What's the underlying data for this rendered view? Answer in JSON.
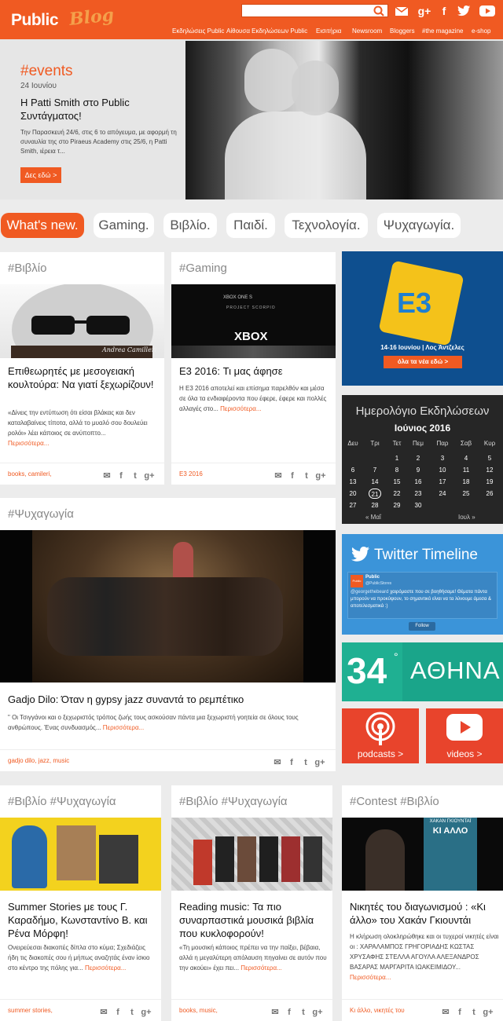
{
  "header": {
    "logo_public": "Public",
    "logo_blog": "Blog",
    "search_placeholder": "",
    "nav": [
      "Εκδηλώσεις Public",
      "Αίθουσα Εκδηλώσεων Public",
      "Εισιτήρια",
      "Newsroom",
      "Bloggers",
      "#the magazine",
      "e-shop"
    ]
  },
  "hero": {
    "tag": "#events",
    "date": "24 Ιουνίου",
    "title": "Η Patti Smith στο Public Συντάγματος!",
    "text": "Την Παρασκευή 24/6, στις 6 το απόγευμα, με αφορμή τη συναυλία της στο Piraeus Academy στις 25/6, η Patti Smith, ιέρεια τ...",
    "button": "Δες εδώ >"
  },
  "tabs": [
    "What's new.",
    "Gaming.",
    "Βιβλίο.",
    "Παιδί.",
    "Τεχνολογία.",
    "Ψυχαγωγία."
  ],
  "cards": {
    "c1": {
      "tag": "#Βιβλίο",
      "title": "Επιθεωρητές με μεσογειακή κουλτούρα: Να γιατί ξεχωρίζουν!",
      "text": "«Δίνεις την εντύπωση ότι είσαι βλάκας και δεν καταλαβαίνεις τίποτα, αλλά το μυαλό σου δουλεύει ρολόι» λέει κάποιος σε ανύποπτο...",
      "more": "Περισσότερα...",
      "tags": "books,  camileri,",
      "img_caption": "Andrea Camilleri"
    },
    "c2": {
      "tag": "#Gaming",
      "title": "E3 2016: Τι μας άφησε",
      "text": "Η E3 2016 αποτελεί και επίσημα παρελθόν και μέσα σε όλα τα ενδιαφέροντα που έφερε, έφερε και πολλές αλλαγές στο...",
      "more": "Περισσότερα...",
      "tags": "E3 2016",
      "img_text": "XBOX",
      "img_sub": "PROJECT SCORPIO",
      "img_top": "XBOX ONE S"
    },
    "c3": {
      "tag": "#Ψυχαγωγία",
      "title": "Gadjo Dilo: Όταν η gypsy jazz συναντά το ρεμπέτικο",
      "text": "\" Οι Τσιγγάνοι και ο ξεχωριστός τρόπος ζωής τους ασκούσαν πάντα μια ξεχωριστή γοητεία σε όλους τους ανθρώπους. Ένας συνδυασμός...",
      "more": "Περισσότερα...",
      "tags": "gadjo dilo,  jazz,  music"
    },
    "c4": {
      "tag": "#Βιβλίο #Ψυχαγωγία",
      "title": "Summer Stories με τους Γ. Καραδήμο, Κωνσταντίνο Β. και Ρένα Μόρφη!",
      "text": "Ονειρεύεσαι διακοπές δίπλα στο κύμα; Σχεδιάζεις ήδη τις διακοπές σου ή μήπως αναζητάς έναν ίσκιο στο κέντρο της πόλης για...",
      "more": "Περισσότερα...",
      "tags": "summer stories,"
    },
    "c5": {
      "tag": "#Βιβλίο #Ψυχαγωγία",
      "title": "Reading music: Τα πιο συναρπαστικά μουσικά βιβλία που κυκλοφορούν!",
      "text": "«Τη μουσική κάποιος πρέπει να την παίξει, βέβαια, αλλά η μεγαλύτερη απόλαυση πηγαίνει σε αυτόν που την ακούει» έχει πει...",
      "more": "Περισσότερα...",
      "tags": "books,  music,"
    },
    "c6": {
      "tag": "#Contest #Βιβλίο",
      "title": "Νικητές του διαγωνισμού : «Κι άλλο» του Χακάν Γκιουντάι",
      "text": "Η κλήρωση ολοκληρώθηκε και οι τυχεροί νικητές είναι οι : ΧΑΡΑΛΑΜΠΟΣ ΓΡΗΓΟΡΙΑΔΗΣ ΚΩΣΤΑΣ ΧΡΥΣΑΦΗΣ ΣΤΕΛΛΑ ΑΓΟΥΛΑ ΑΛΕΞΑΝΔΡΟΣ ΒΑΣΑΡΑΣ ΜΑΡΓΑΡΙΤΑ ΙΩΑΚΕΙΜΙΔΟΥ...",
      "more": "Περισσότερα...",
      "tags": "Κι άλλο,  νικητές του",
      "img_title": "ΧΑΚΑΝ ΓΚΙΟΥΝΤΑΪ",
      "img_title2": "ΚΙ ΑΛΛΟ"
    }
  },
  "e3": {
    "logo": "E3",
    "dates": "14-16 Ιουνίου | Λος Άντζελες",
    "button": "όλα τα νέα εδώ >"
  },
  "calendar": {
    "title": "Ημερολόγιο Εκδηλώσεων",
    "month": "Ιούνιος 2016",
    "days": [
      "Δευ",
      "Τρι",
      "Τετ",
      "Πεμ",
      "Παρ",
      "Σαβ",
      "Κυρ"
    ],
    "weeks": [
      [
        "",
        "",
        "1",
        "2",
        "3",
        "4",
        "5"
      ],
      [
        "6",
        "7",
        "8",
        "9",
        "10",
        "11",
        "12"
      ],
      [
        "13",
        "14",
        "15",
        "16",
        "17",
        "18",
        "19"
      ],
      [
        "20",
        "21",
        "22",
        "23",
        "24",
        "25",
        "26"
      ],
      [
        "27",
        "28",
        "29",
        "30",
        "",
        "",
        ""
      ]
    ],
    "today": "21",
    "prev": "« Μαΐ",
    "next": "Ιουλ »"
  },
  "twitter": {
    "title": "Twitter Timeline",
    "name": "Public",
    "handle": "@PublicStores",
    "tweet_mention": "@georgethebeard",
    "tweet": "χαιρόμαστε που σε βοηθήσαμε! Θέματα πάντα μπορούν να προκύψουν, το σημαντικό είναι να τα λύνουμε άμεσα & αποτελεσματικά :)",
    "follow": "Follow",
    "avatar": "Public"
  },
  "weather": {
    "temp": "34",
    "deg": "°",
    "city": "ΑΘΗΝΑ"
  },
  "podcasts": {
    "label": "podcasts >"
  },
  "videos": {
    "label": "videos >"
  },
  "colors": {
    "brand": "#f05a22",
    "e3": "#0e4f8f",
    "twitter": "#3b94d9",
    "weather": "#1aa58a",
    "media": "#e8442c"
  }
}
